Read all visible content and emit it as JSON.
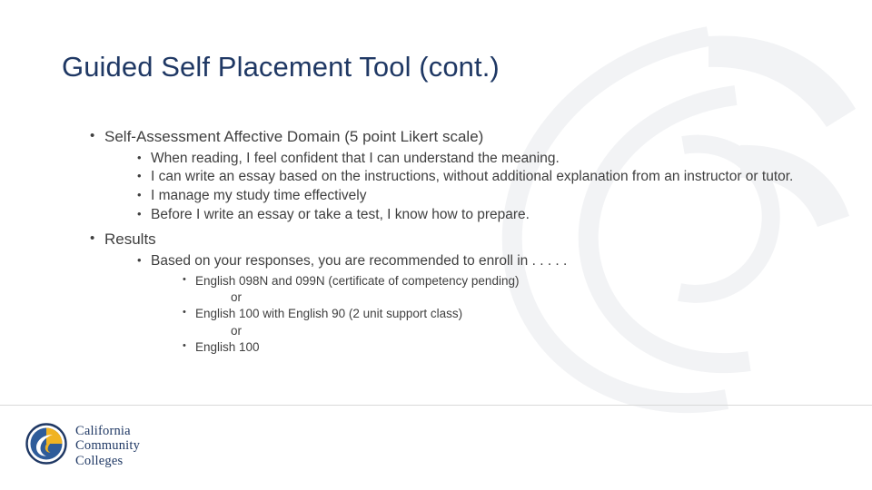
{
  "slide": {
    "title": "Guided Self Placement Tool (cont.)",
    "title_color": "#1f3864",
    "bullets": [
      {
        "text": "Self-Assessment Affective Domain (5 point Likert scale)",
        "children": [
          {
            "text": "When reading, I feel confident that I can understand the meaning."
          },
          {
            "text": "I can write an essay based on the instructions, without additional explanation from an instructor or tutor."
          },
          {
            "text": "I manage my study time effectively"
          },
          {
            "text": "Before I write an essay or take a test, I know how to prepare."
          }
        ]
      },
      {
        "text": "Results",
        "children": [
          {
            "text": "Based on your responses, you are recommended to enroll in . . . . .",
            "children": [
              {
                "text": "English 098N and 099N (certificate of competency pending)"
              },
              {
                "text": "or",
                "is_connector": true
              },
              {
                "text": "English 100 with English 90 (2 unit support class)"
              },
              {
                "text": "or",
                "is_connector": true
              },
              {
                "text": "English 100"
              }
            ]
          }
        ]
      }
    ],
    "bullet_glyph": "•"
  },
  "footer": {
    "logo_line1": "California",
    "logo_line2": "Community",
    "logo_line3": "Colleges",
    "logo_colors": {
      "navy": "#1f3864",
      "gold": "#f0b323",
      "blue": "#2e5c9a"
    }
  }
}
